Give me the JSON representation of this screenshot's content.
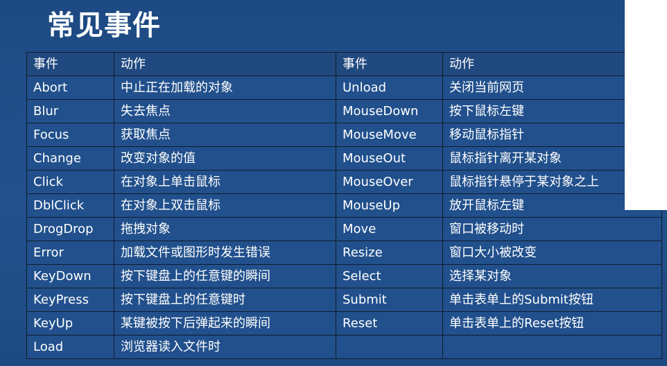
{
  "title": "常见事件",
  "table": {
    "headers": [
      "事件",
      "动作",
      "事件",
      "动作"
    ],
    "rows": [
      [
        "Abort",
        "中止正在加载的对象",
        "Unload",
        "关闭当前网页"
      ],
      [
        "Blur",
        "失去焦点",
        "MouseDown",
        "按下鼠标左键"
      ],
      [
        "Focus",
        "获取焦点",
        "MouseMove",
        "移动鼠标指针"
      ],
      [
        "Change",
        "改变对象的值",
        "MouseOut",
        "鼠标指针离开某对象"
      ],
      [
        "Click",
        "在对象上单击鼠标",
        "MouseOver",
        "鼠标指针悬停于某对象之上"
      ],
      [
        "DblClick",
        "在对象上双击鼠标",
        "MouseUp",
        "放开鼠标左键"
      ],
      [
        "DrogDrop",
        "拖拽对象",
        "Move",
        "窗口被移动时"
      ],
      [
        "Error",
        "加载文件或图形时发生错误",
        "Resize",
        "窗口大小被改变"
      ],
      [
        "KeyDown",
        "按下键盘上的任意键的瞬间",
        "Select",
        "选择某对象"
      ],
      [
        "KeyPress",
        "按下键盘上的任意键时",
        "Submit",
        "单击表单上的Submit按钮"
      ],
      [
        "KeyUp",
        "某键被按下后弹起来的瞬间",
        "Reset",
        "单击表单上的Reset按钮"
      ],
      [
        "Load",
        "浏览器读入文件时",
        "",
        ""
      ]
    ]
  }
}
